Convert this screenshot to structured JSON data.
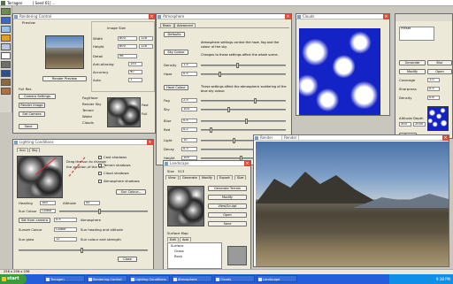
{
  "desktop": {
    "title": "Terragen",
    "title_extra": "[ Seed 61] ...",
    "status_text": "256 x 256 x 256"
  },
  "preview_win": {
    "title": "Rendering Control",
    "preview_label": "Preview",
    "render_preview_btn": "Render Preview",
    "camera_settings_btn": "Camera Settings",
    "full_res_label": "Full Res",
    "image_size_label": "Image Size",
    "width_label": "Width",
    "width_val": "800",
    "height_label": "Height",
    "height_val": "600",
    "detail_label": "Detail",
    "aa_label": "Anti-aliasing",
    "acc_label": "Accuracy",
    "fields": [
      "128",
      "128",
      "96",
      "150",
      "90",
      "1"
    ],
    "side_labels": [
      "Fog/Haze",
      "Render Sky",
      "Terrain",
      "Water",
      "Clouds"
    ],
    "small_btns": [
      "Render Image",
      "Set Camera",
      "Save"
    ],
    "spin_labels": [
      "Auto",
      "Fast",
      "Full"
    ]
  },
  "lighting_win": {
    "title": "Lighting Conditions",
    "tabs": [
      "Sun",
      "Sky"
    ],
    "hints": [
      "Drag the sun to change",
      "the position of the sun.",
      "Sun heading and altitude",
      "Sun colour and strength"
    ],
    "labels": [
      "Heading",
      "Altitude",
      "Sun Colour",
      "Atmosphere",
      "Sunset Colour",
      "Sun glow"
    ],
    "values": [
      "180",
      "45",
      "Colour",
      "0.5",
      "Colour",
      "12"
    ],
    "checks": [
      "Cast shadows",
      "Terrain shadows",
      "Cloud shadows",
      "Atmosphere shadows"
    ],
    "buttons": [
      "Sun Colour...",
      "Set from camera",
      "Close"
    ]
  },
  "atmo_win": {
    "title": "Atmosphere",
    "tabs": [
      "Basic",
      "Advanced"
    ],
    "paragraphs": [
      "Atmosphere settings control the haze, fog and the colour of the sky.",
      "Changes to these settings affect the whole scene.",
      "These settings affect the atmospheric scattering of the blue sky colour."
    ],
    "rows": [
      "Density",
      "Haze",
      "Fog",
      "Sky",
      "Blue",
      "Red",
      "Light",
      "Decay",
      "Height"
    ],
    "values": [
      "1.5",
      "0.5",
      "2.5",
      "100",
      "0.5",
      "0.2",
      "10",
      "0.3",
      "100"
    ],
    "buttons": [
      "Defaults",
      "Sky Colour",
      "Haze Colour"
    ]
  },
  "cloud_win": {
    "title": "Clouds"
  },
  "cloud_ctrl": {
    "title": "Cloud Control",
    "buttons": [
      "Generate",
      "Blur",
      "Modify",
      "Open",
      "Save",
      "Preset"
    ],
    "labels": [
      "Coverage",
      "Sharpness",
      "Density",
      "Altitude",
      "Depth"
    ],
    "values": [
      "1.0",
      "0.5",
      "0.6",
      "500",
      "2000"
    ]
  },
  "landscape_win": {
    "title": "Landscape",
    "size_label": "Size",
    "size_val": "513",
    "tabs": [
      "View",
      "Generate",
      "Modify",
      "Export",
      "Size"
    ],
    "buttons": [
      "Generate Terrain",
      "Modify",
      "View/Sculpt",
      "Open",
      "Save",
      "Export"
    ],
    "surface_label": "Surface Map",
    "surface_items": [
      "Surface",
      "Grass",
      "Rock"
    ],
    "surface_tabs": [
      "Edit",
      "Add"
    ]
  },
  "render_win": {
    "title": "Render",
    "subtitle": "[ Render ]"
  },
  "taskbar": {
    "start": "start",
    "items": [
      "Terragen",
      "Rendering Control",
      "Lighting Conditions",
      "Atmosphere",
      "Clouds",
      "Landscape"
    ],
    "clock": "9:38 PM"
  }
}
